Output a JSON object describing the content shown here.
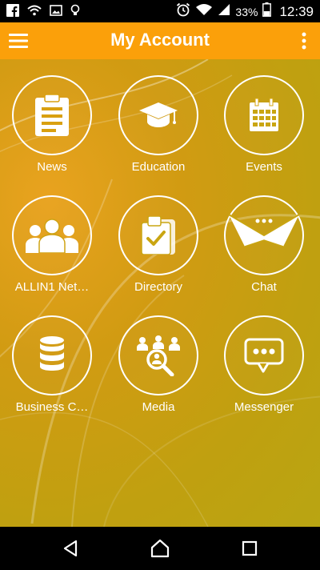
{
  "status_bar": {
    "battery_percent": "33%",
    "clock": "12:39",
    "icons": [
      "facebook-icon",
      "wifi-icon",
      "image-icon",
      "lightbulb-icon",
      "alarm-icon",
      "wifi-signal-icon",
      "cell-signal-icon",
      "battery-icon"
    ]
  },
  "app_bar": {
    "title": "My Account",
    "menu_icon": "hamburger-menu-icon",
    "overflow_icon": "more-vertical-icon",
    "color": "#FBA00A"
  },
  "grid": {
    "items": [
      {
        "label": "News",
        "icon": "clipboard-icon"
      },
      {
        "label": "Education",
        "icon": "graduation-cap-icon"
      },
      {
        "label": "Events",
        "icon": "calendar-icon"
      },
      {
        "label": "ALLIN1 Net…",
        "icon": "people-group-icon"
      },
      {
        "label": "Directory",
        "icon": "directory-check-icon"
      },
      {
        "label": "Chat",
        "icon": "envelope-icon"
      },
      {
        "label": "Business C…",
        "icon": "database-icon"
      },
      {
        "label": "Media",
        "icon": "people-search-icon"
      },
      {
        "label": "Messenger",
        "icon": "speech-bubble-icon"
      }
    ]
  },
  "nav_bar": {
    "icons": [
      "back-icon",
      "home-icon",
      "recents-icon"
    ]
  }
}
